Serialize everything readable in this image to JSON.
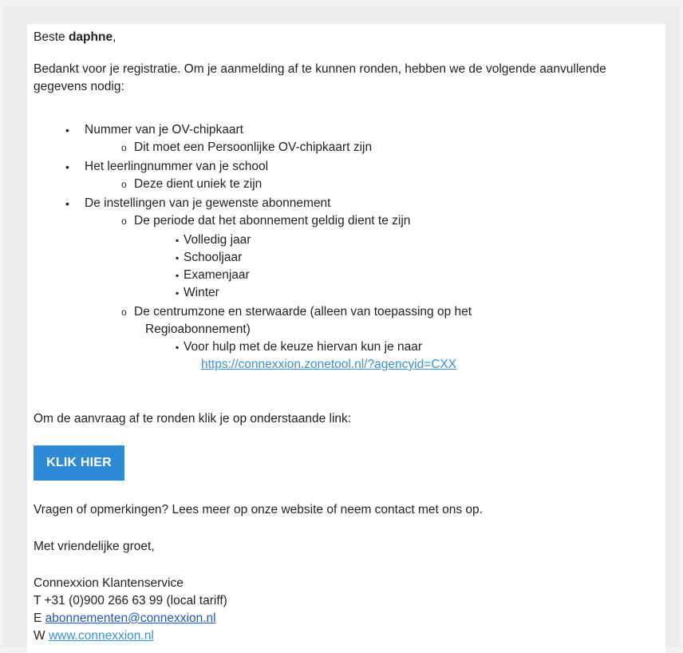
{
  "greeting": {
    "prefix": "Beste",
    "name": "daphne",
    "suffix": ","
  },
  "intro": "Bedankt voor je registratie. Om je aanmelding af te kunnen ronden, hebben we de volgende aanvullende gegevens nodig:",
  "requirements": {
    "item1": "Nummer van je OV-chipkaart",
    "item1_sub": "Dit moet een Persoonlijke OV-chipkaart zijn",
    "item2": "Het leerlingnummer van je school",
    "item2_sub": "Deze dient uniek te zijn",
    "item3": "De instellingen van je gewenste abonnement",
    "item3_sub1": "De periode dat het abonnement geldig dient te zijn",
    "periods": [
      "Volledig jaar",
      "Schooljaar",
      "Examenjaar",
      "Winter"
    ],
    "item3_sub2_line1": "De centrumzone en sterwaarde (alleen van toepassing op het",
    "item3_sub2_line2": "Regioabonnement)",
    "help_text": "Voor hulp met de keuze hiervan kun je naar",
    "help_link": "https://connexxion.zonetool.nl/?agencyid=CXX"
  },
  "finish_text": "Om de aanvraag af te ronden klik je op onderstaande link:",
  "button_label": "KLIK HIER",
  "questions": "Vragen of opmerkingen? Lees meer op onze website of neem contact met ons op.",
  "regards": "Met vriendelijke groet,",
  "signature": {
    "company": "Connexxion Klantenservice",
    "phone": "T +31 (0)900 266 63 99 (local tariff)",
    "email_prefix": "E",
    "email": "abonnementen@connexxion.nl",
    "web_prefix": "W",
    "website": "www.connexxion.nl"
  },
  "colors": {
    "button": "#2e89d6",
    "link": "#1a5bb8"
  }
}
